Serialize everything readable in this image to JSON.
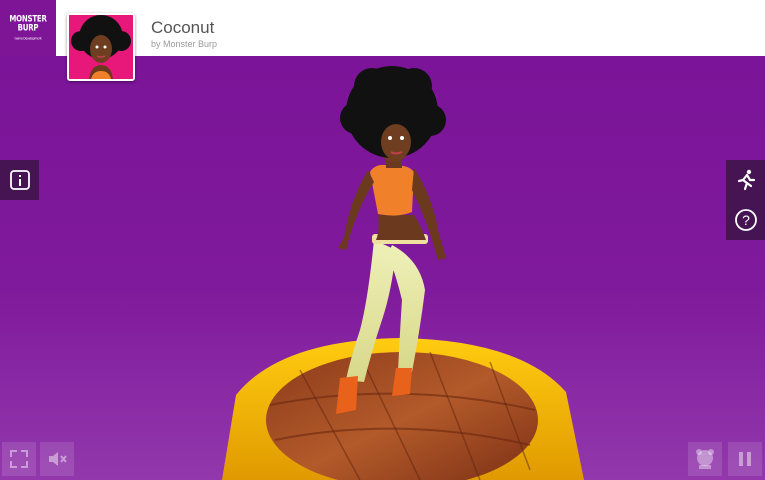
{
  "logo": {
    "line1": "MONSTER",
    "line2": "BURP",
    "sub": "Game Development"
  },
  "model": {
    "title": "Coconut",
    "author": "by Monster Burp"
  },
  "controls": {
    "info_icon": "info-icon",
    "animation_icon": "running-figure-icon",
    "help_icon": "question-icon",
    "fullscreen_icon": "expand-icon",
    "sound_icon": "speaker-mute-icon",
    "character_icon": "character-icon",
    "pause_icon": "pause-icon"
  },
  "colors": {
    "background": "#7a1296",
    "platform_rim": "#f5b800",
    "thumbnail_bg": "#e8177a"
  }
}
